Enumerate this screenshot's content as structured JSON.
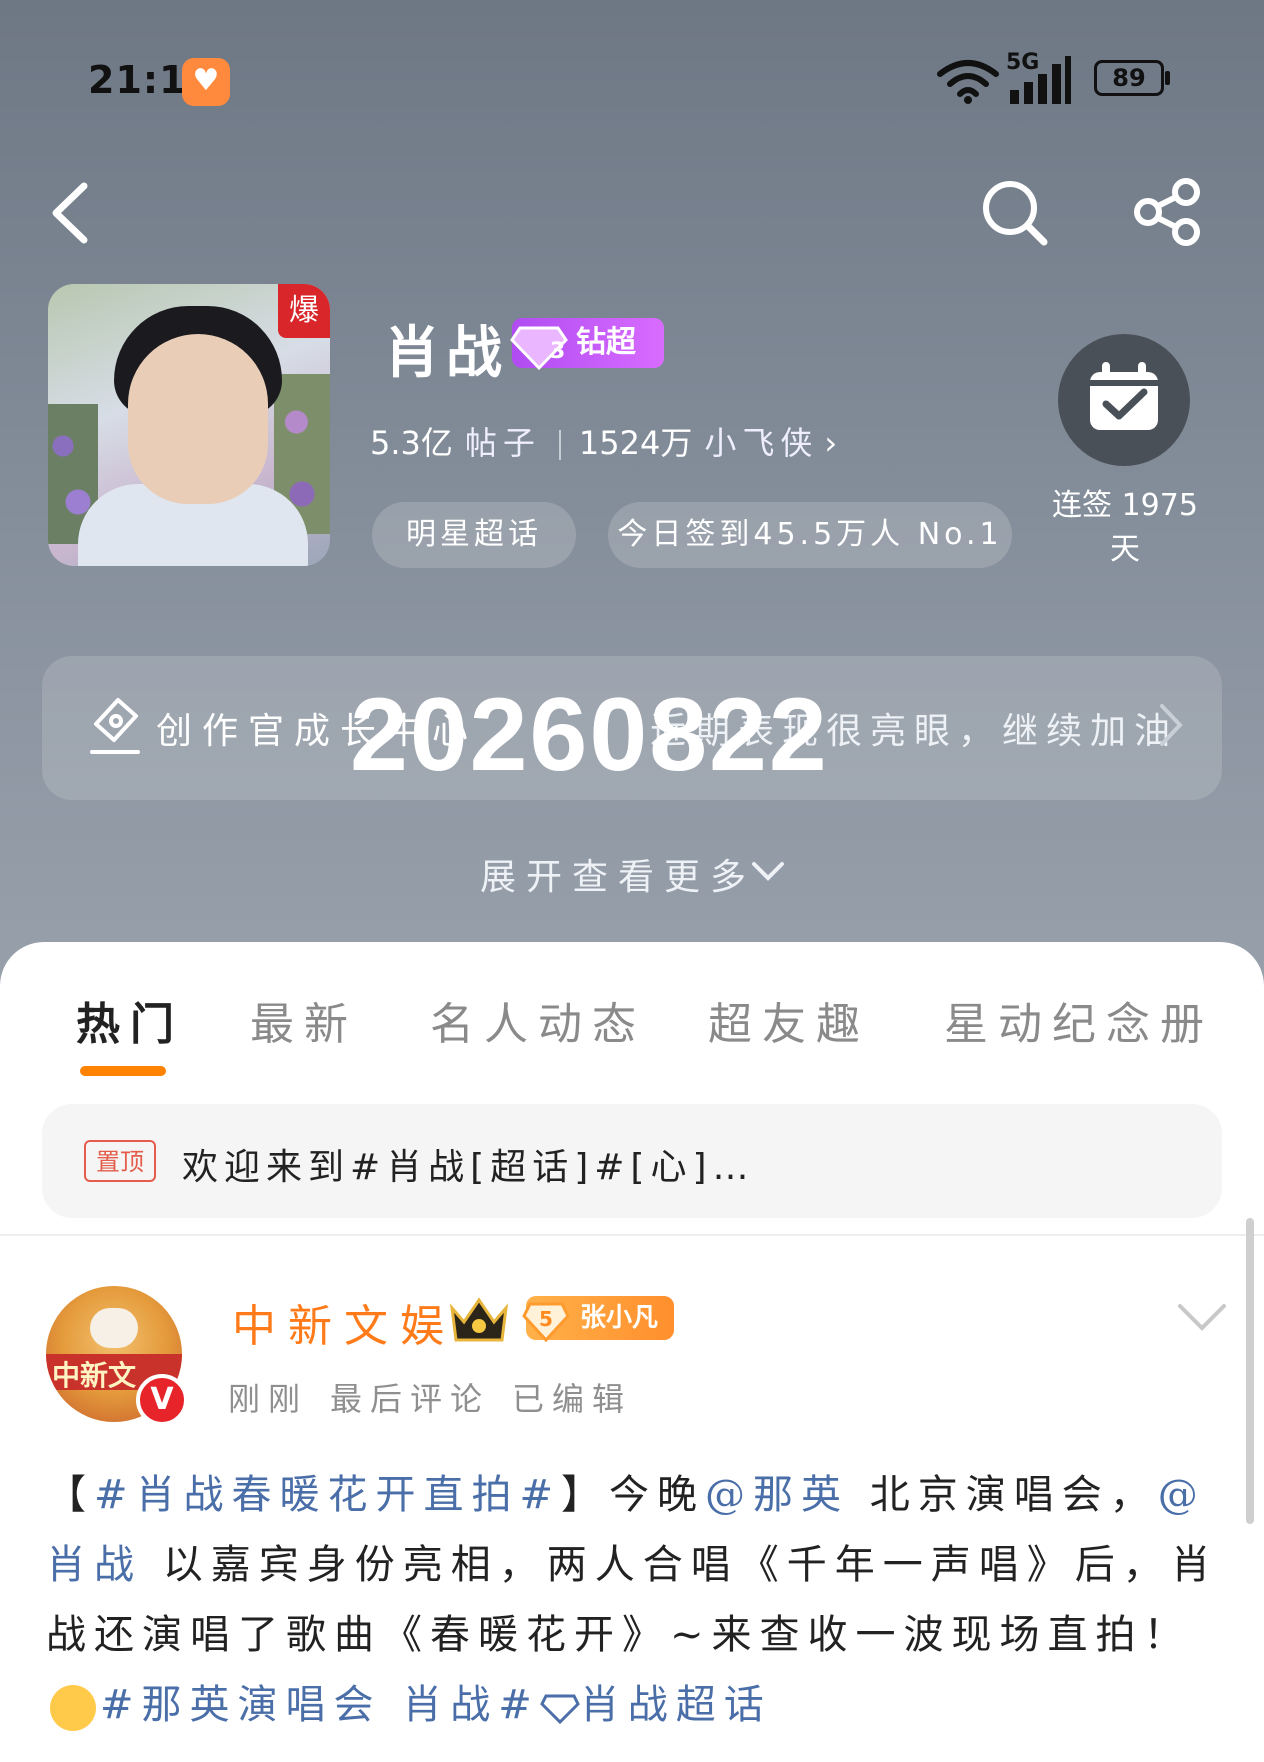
{
  "status_bar": {
    "time": "21:13",
    "network": "5G",
    "battery": "89"
  },
  "topic": {
    "name": "肖战",
    "level_badge": "钻超",
    "level_number": "3",
    "hot_badge": "爆",
    "posts_count": "5.3亿",
    "posts_unit": "帖子",
    "fans_count": "1524万",
    "fans_unit": "小飞侠",
    "category_pill": "明星超话",
    "checkin_pill": "今日签到45.5万人 No.1",
    "checkin_streak_line1": "连签 1975",
    "checkin_streak_line2": "天"
  },
  "creator_bar": {
    "left_text": "创作官成长中心",
    "right_text": "近期表现很亮眼，继续加油"
  },
  "watermark": "20260822",
  "expand_label": "展开查看更多",
  "tabs": [
    {
      "label": "热门",
      "active": true
    },
    {
      "label": "最新",
      "active": false
    },
    {
      "label": "名人动态",
      "active": false
    },
    {
      "label": "超友趣",
      "active": false
    },
    {
      "label": "星动纪念册",
      "active": false
    }
  ],
  "pinned": {
    "tag": "置顶",
    "text": "欢迎来到#肖战[超话]#[心]…"
  },
  "post": {
    "author": "中新文娱",
    "avatar_text": "中新文",
    "fan_level": "5",
    "fan_name": "张小凡",
    "verified": "V",
    "meta_time": "刚刚",
    "meta_comment": "最后评论",
    "meta_edited": "已编辑",
    "body": {
      "bracket_open": "【",
      "hashtag1": "#肖战春暖花开直拍#",
      "bracket_close": "】",
      "t1": "今晚",
      "mention1": "@那英",
      "t2": " 北京演唱会，",
      "mention2": "@肖战",
      "t3": " 以嘉宾身份亮相，两人合唱《千年一声唱》后，肖战还演唱了歌曲《春暖花开》~来查收一波现场直拍！",
      "hashtag2": "#那英演唱会 肖战#",
      "hashtag3": "肖战超话"
    }
  },
  "colors": {
    "accent": "#ff8200",
    "link": "#4a6ea8",
    "author": "#ff7b1a",
    "badge_purple": "#b04cf2"
  }
}
